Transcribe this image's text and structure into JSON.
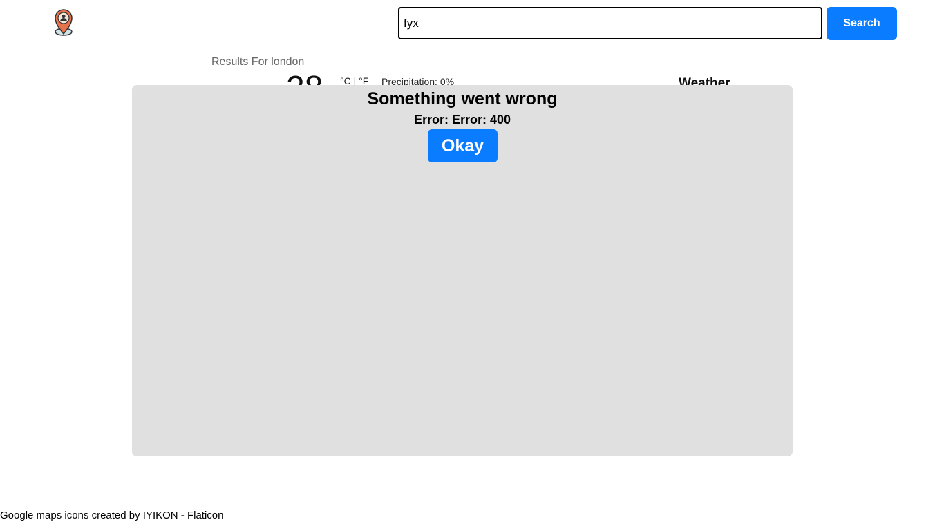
{
  "header": {
    "logo_icon": "map-pin-person-icon",
    "search": {
      "value": "fyx",
      "placeholder": ""
    },
    "search_button_label": "Search"
  },
  "results": {
    "label": "Results For london",
    "temperature": "28",
    "units": "°C | °F",
    "precipitation": "Precipitation: 0%",
    "weather_heading": "Weather"
  },
  "modal": {
    "title": "Something went wrong",
    "message": "Error: Error: 400",
    "button_label": "Okay"
  },
  "footer": {
    "attribution": "Google maps icons created by IYIKON - Flaticon"
  },
  "colors": {
    "accent": "#0a7cff",
    "modal_background": "#e0e0e0",
    "logo_pin": "#e8734a"
  }
}
